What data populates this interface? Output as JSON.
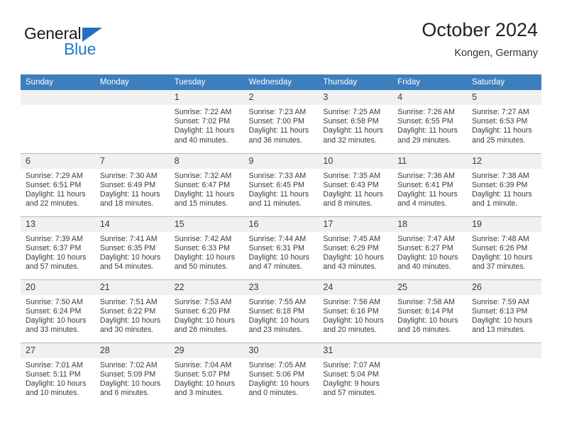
{
  "logo": {
    "word1": "General",
    "word2": "Blue",
    "triangle_color": "#1f6fc4",
    "blue_text_color": "#1f7ac4"
  },
  "header": {
    "title": "October 2024",
    "subtitle": "Kongen, Germany"
  },
  "theme": {
    "header_blue": "#3d7ebc",
    "daynum_bg": "#f0f0f0",
    "grid_line": "#b9b9b9",
    "text": "#3a3a3a"
  },
  "weekday_headers": [
    "Sunday",
    "Monday",
    "Tuesday",
    "Wednesday",
    "Thursday",
    "Friday",
    "Saturday"
  ],
  "labels": {
    "sunrise_prefix": "Sunrise:",
    "sunset_prefix": "Sunset:",
    "daylight_prefix": "Daylight:"
  },
  "weeks": [
    [
      {
        "day": "",
        "lines": [
          "",
          "",
          "",
          ""
        ]
      },
      {
        "day": "",
        "lines": [
          "",
          "",
          "",
          ""
        ]
      },
      {
        "day": "1",
        "lines": [
          "Sunrise: 7:22 AM",
          "Sunset: 7:02 PM",
          "Daylight: 11 hours",
          "and 40 minutes."
        ]
      },
      {
        "day": "2",
        "lines": [
          "Sunrise: 7:23 AM",
          "Sunset: 7:00 PM",
          "Daylight: 11 hours",
          "and 36 minutes."
        ]
      },
      {
        "day": "3",
        "lines": [
          "Sunrise: 7:25 AM",
          "Sunset: 6:58 PM",
          "Daylight: 11 hours",
          "and 32 minutes."
        ]
      },
      {
        "day": "4",
        "lines": [
          "Sunrise: 7:26 AM",
          "Sunset: 6:55 PM",
          "Daylight: 11 hours",
          "and 29 minutes."
        ]
      },
      {
        "day": "5",
        "lines": [
          "Sunrise: 7:27 AM",
          "Sunset: 6:53 PM",
          "Daylight: 11 hours",
          "and 25 minutes."
        ]
      }
    ],
    [
      {
        "day": "6",
        "lines": [
          "Sunrise: 7:29 AM",
          "Sunset: 6:51 PM",
          "Daylight: 11 hours",
          "and 22 minutes."
        ]
      },
      {
        "day": "7",
        "lines": [
          "Sunrise: 7:30 AM",
          "Sunset: 6:49 PM",
          "Daylight: 11 hours",
          "and 18 minutes."
        ]
      },
      {
        "day": "8",
        "lines": [
          "Sunrise: 7:32 AM",
          "Sunset: 6:47 PM",
          "Daylight: 11 hours",
          "and 15 minutes."
        ]
      },
      {
        "day": "9",
        "lines": [
          "Sunrise: 7:33 AM",
          "Sunset: 6:45 PM",
          "Daylight: 11 hours",
          "and 11 minutes."
        ]
      },
      {
        "day": "10",
        "lines": [
          "Sunrise: 7:35 AM",
          "Sunset: 6:43 PM",
          "Daylight: 11 hours",
          "and 8 minutes."
        ]
      },
      {
        "day": "11",
        "lines": [
          "Sunrise: 7:36 AM",
          "Sunset: 6:41 PM",
          "Daylight: 11 hours",
          "and 4 minutes."
        ]
      },
      {
        "day": "12",
        "lines": [
          "Sunrise: 7:38 AM",
          "Sunset: 6:39 PM",
          "Daylight: 11 hours",
          "and 1 minute."
        ]
      }
    ],
    [
      {
        "day": "13",
        "lines": [
          "Sunrise: 7:39 AM",
          "Sunset: 6:37 PM",
          "Daylight: 10 hours",
          "and 57 minutes."
        ]
      },
      {
        "day": "14",
        "lines": [
          "Sunrise: 7:41 AM",
          "Sunset: 6:35 PM",
          "Daylight: 10 hours",
          "and 54 minutes."
        ]
      },
      {
        "day": "15",
        "lines": [
          "Sunrise: 7:42 AM",
          "Sunset: 6:33 PM",
          "Daylight: 10 hours",
          "and 50 minutes."
        ]
      },
      {
        "day": "16",
        "lines": [
          "Sunrise: 7:44 AM",
          "Sunset: 6:31 PM",
          "Daylight: 10 hours",
          "and 47 minutes."
        ]
      },
      {
        "day": "17",
        "lines": [
          "Sunrise: 7:45 AM",
          "Sunset: 6:29 PM",
          "Daylight: 10 hours",
          "and 43 minutes."
        ]
      },
      {
        "day": "18",
        "lines": [
          "Sunrise: 7:47 AM",
          "Sunset: 6:27 PM",
          "Daylight: 10 hours",
          "and 40 minutes."
        ]
      },
      {
        "day": "19",
        "lines": [
          "Sunrise: 7:48 AM",
          "Sunset: 6:26 PM",
          "Daylight: 10 hours",
          "and 37 minutes."
        ]
      }
    ],
    [
      {
        "day": "20",
        "lines": [
          "Sunrise: 7:50 AM",
          "Sunset: 6:24 PM",
          "Daylight: 10 hours",
          "and 33 minutes."
        ]
      },
      {
        "day": "21",
        "lines": [
          "Sunrise: 7:51 AM",
          "Sunset: 6:22 PM",
          "Daylight: 10 hours",
          "and 30 minutes."
        ]
      },
      {
        "day": "22",
        "lines": [
          "Sunrise: 7:53 AM",
          "Sunset: 6:20 PM",
          "Daylight: 10 hours",
          "and 26 minutes."
        ]
      },
      {
        "day": "23",
        "lines": [
          "Sunrise: 7:55 AM",
          "Sunset: 6:18 PM",
          "Daylight: 10 hours",
          "and 23 minutes."
        ]
      },
      {
        "day": "24",
        "lines": [
          "Sunrise: 7:56 AM",
          "Sunset: 6:16 PM",
          "Daylight: 10 hours",
          "and 20 minutes."
        ]
      },
      {
        "day": "25",
        "lines": [
          "Sunrise: 7:58 AM",
          "Sunset: 6:14 PM",
          "Daylight: 10 hours",
          "and 16 minutes."
        ]
      },
      {
        "day": "26",
        "lines": [
          "Sunrise: 7:59 AM",
          "Sunset: 6:13 PM",
          "Daylight: 10 hours",
          "and 13 minutes."
        ]
      }
    ],
    [
      {
        "day": "27",
        "lines": [
          "Sunrise: 7:01 AM",
          "Sunset: 5:11 PM",
          "Daylight: 10 hours",
          "and 10 minutes."
        ]
      },
      {
        "day": "28",
        "lines": [
          "Sunrise: 7:02 AM",
          "Sunset: 5:09 PM",
          "Daylight: 10 hours",
          "and 6 minutes."
        ]
      },
      {
        "day": "29",
        "lines": [
          "Sunrise: 7:04 AM",
          "Sunset: 5:07 PM",
          "Daylight: 10 hours",
          "and 3 minutes."
        ]
      },
      {
        "day": "30",
        "lines": [
          "Sunrise: 7:05 AM",
          "Sunset: 5:06 PM",
          "Daylight: 10 hours",
          "and 0 minutes."
        ]
      },
      {
        "day": "31",
        "lines": [
          "Sunrise: 7:07 AM",
          "Sunset: 5:04 PM",
          "Daylight: 9 hours",
          "and 57 minutes."
        ]
      },
      {
        "day": "",
        "lines": [
          "",
          "",
          "",
          ""
        ]
      },
      {
        "day": "",
        "lines": [
          "",
          "",
          "",
          ""
        ]
      }
    ]
  ]
}
